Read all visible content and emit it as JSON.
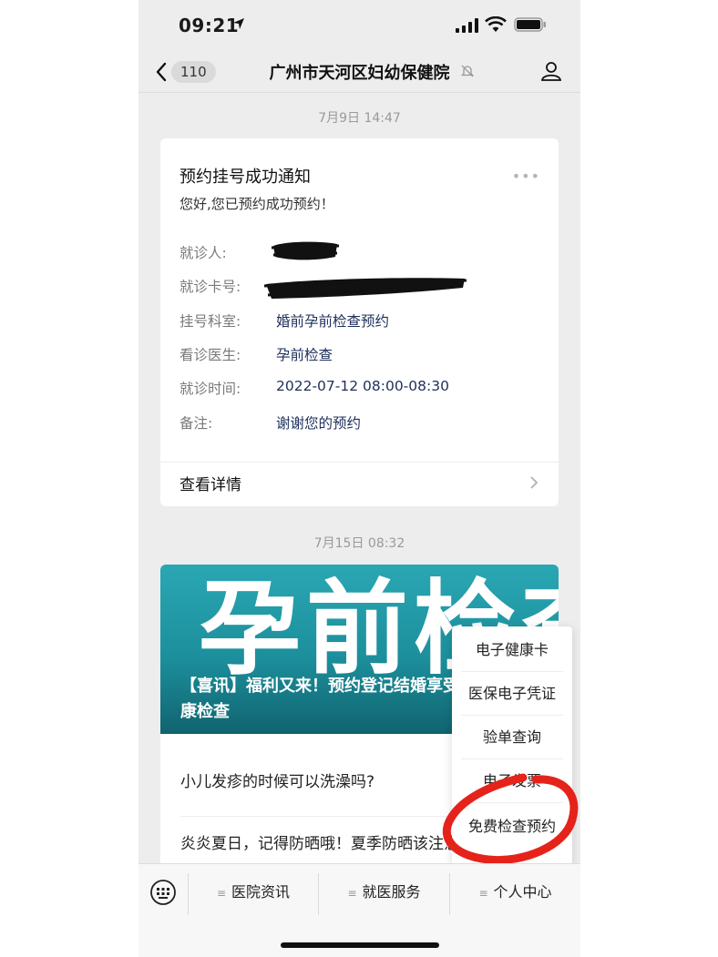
{
  "status_bar": {
    "time": "09:21"
  },
  "nav": {
    "back_count": "110",
    "title": "广州市天河区妇幼保健院"
  },
  "messages": [
    {
      "timestamp": "7月9日 14:47",
      "card": {
        "title": "预约挂号成功通知",
        "more": "•••",
        "subtitle": "您好,您已预约成功预约！",
        "rows": [
          {
            "label": "就诊人:",
            "value": ""
          },
          {
            "label": "就诊卡号:",
            "value": ""
          },
          {
            "label": "挂号科室:",
            "value": "婚前孕前检查预约"
          },
          {
            "label": "看诊医生:",
            "value": "孕前检查"
          },
          {
            "label": "就诊时间:",
            "value": "2022-07-12 08:00-08:30"
          },
          {
            "label": "备注:",
            "value": "谢谢您的预约"
          }
        ],
        "detail_link": "查看详情"
      }
    },
    {
      "timestamp": "7月15日 08:32",
      "article": {
        "banner_text": "孕前检查",
        "headline": "【喜讯】福利又来！预约登记结婚享受免费婚孕健康检查",
        "items": [
          "小儿发疹的时候可以洗澡吗?",
          "炎炎夏日，记得防晒哦！夏季防晒该注意什么?"
        ]
      }
    }
  ],
  "popup_menu": {
    "items": [
      "电子健康卡",
      "医保电子凭证",
      "验单查询",
      "电子发票",
      "免费检查预约"
    ]
  },
  "bottom_menu": {
    "tabs": [
      "医院资讯",
      "就医服务",
      "个人中心"
    ]
  },
  "colors": {
    "value_text": "#1e2f5a",
    "banner": "#1c8f9c",
    "highlight_circle": "#e5231b"
  }
}
